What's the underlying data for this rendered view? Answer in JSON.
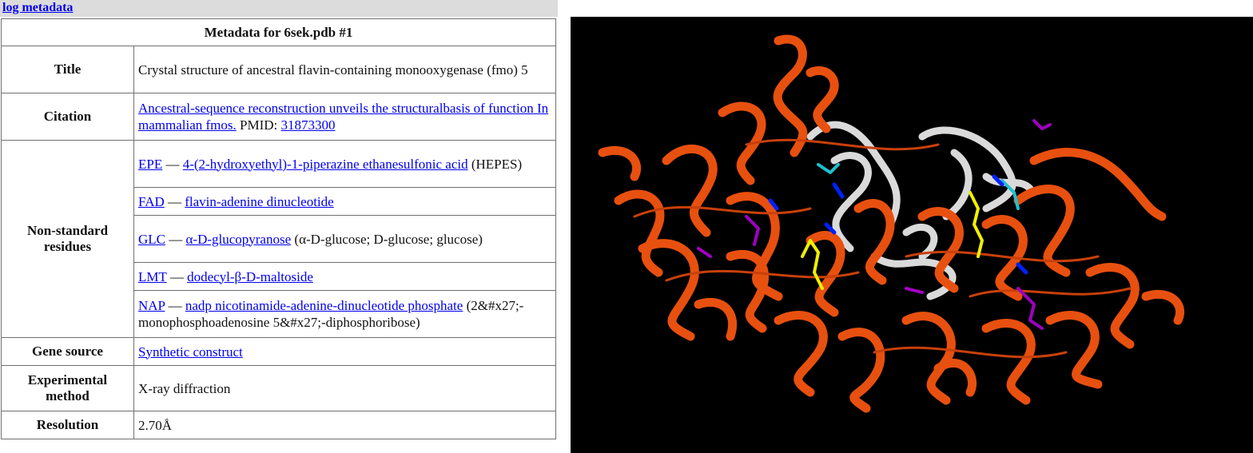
{
  "log": {
    "header_link": "log metadata",
    "caption": "Metadata for 6sek.pdb #1",
    "rows": {
      "title": {
        "label": "Title",
        "value": "Crystal structure of ancestral flavin-containing monooxygenase (fmo) 5"
      },
      "citation": {
        "label": "Citation",
        "link": "Ancestral-sequence reconstruction unveils the structuralbasis of function In mammalian fmos.",
        "pmid_label": " PMID: ",
        "pmid": "31873300"
      },
      "nonstandard": {
        "label": "Non-standard residues",
        "items": [
          {
            "code": "EPE",
            "sep": " — ",
            "name": "4-(2-hydroxyethyl)-1-piperazine ethanesulfonic acid",
            "extra": " (HEPES)"
          },
          {
            "code": "FAD",
            "sep": " — ",
            "name": "flavin-adenine dinucleotide",
            "extra": ""
          },
          {
            "code": "GLC",
            "sep": " — ",
            "name": "α-D-glucopyranose",
            "extra": " (α-D-glucose; D-glucose; glucose)"
          },
          {
            "code": "LMT",
            "sep": " — ",
            "name": "dodecyl-β-D-maltoside",
            "extra": ""
          },
          {
            "code": "NAP",
            "sep": " — ",
            "name": "nadp nicotinamide-adenine-dinucleotide phosphate",
            "extra": " (2&#x27;-monophosphoadenosine 5&#x27;-diphosphoribose)"
          }
        ]
      },
      "gene_source": {
        "label": "Gene source",
        "link": "Synthetic construct"
      },
      "experimental": {
        "label": "Experimental method",
        "value": "X-ray diffraction"
      },
      "resolution": {
        "label": "Resolution",
        "value": "2.70Å"
      }
    }
  },
  "viewer": {
    "background": "#000000",
    "colors": {
      "chain_a": "#e8500f",
      "chain_b": "#e8e8e8",
      "ligand_yellow": "#f0f000",
      "ligand_magenta": "#a000c0",
      "ligand_cyan": "#20c0d0",
      "ligand_blue": "#0020ff"
    }
  }
}
